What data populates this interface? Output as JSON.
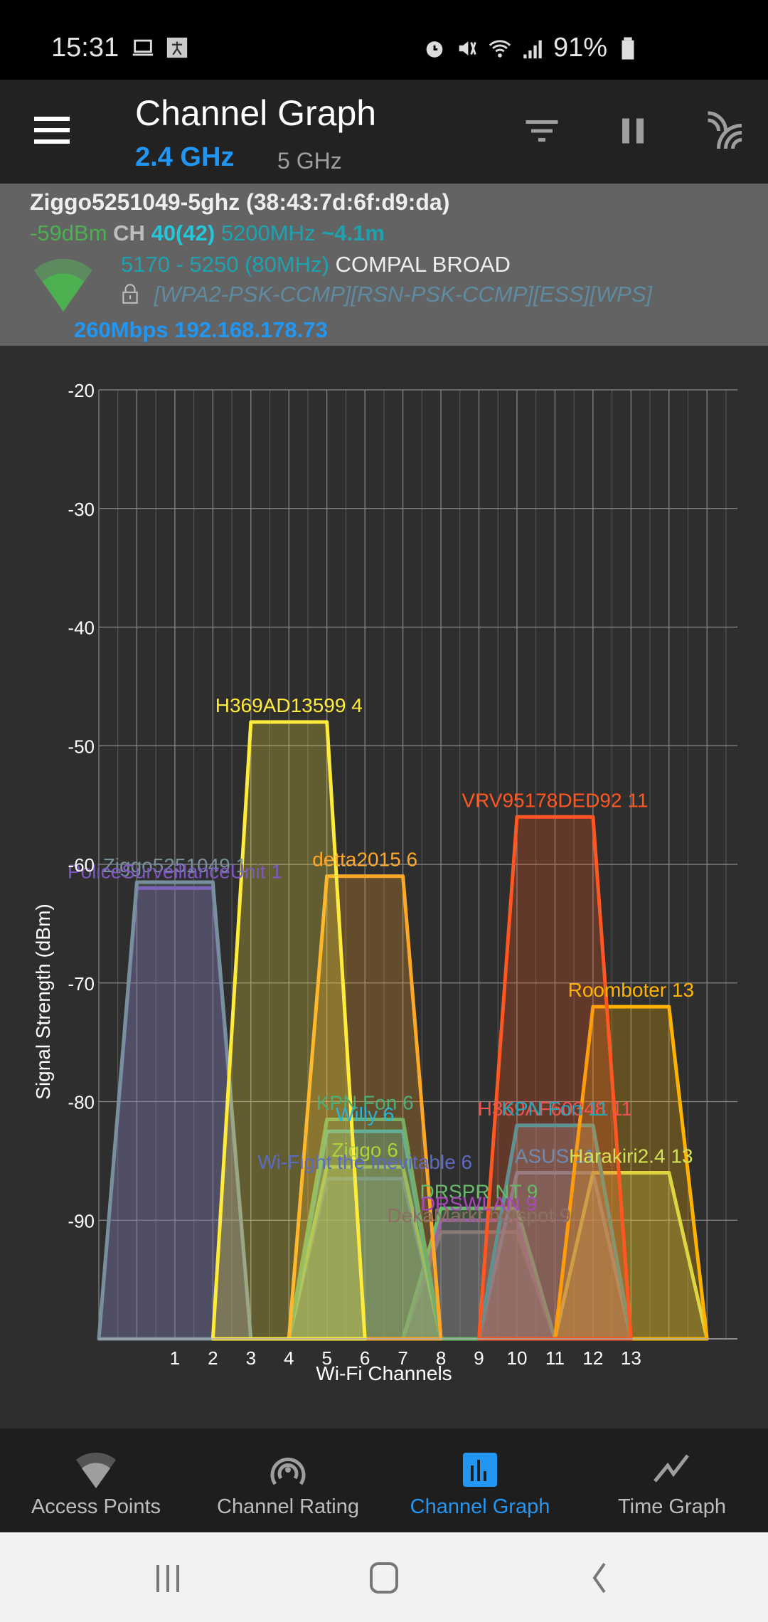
{
  "status_bar": {
    "time": "15:31",
    "battery": "91%",
    "left_icons": [
      "laptop-icon",
      "app-notification-icon"
    ],
    "right_icons": [
      "alarm-icon",
      "vibrate-icon",
      "wifi-data-icon",
      "cellular-signal-icon",
      "battery-icon"
    ]
  },
  "toolbar": {
    "title": "Channel Graph",
    "bands": [
      {
        "label": "2.4 GHz",
        "active": true
      },
      {
        "label": "5 GHz",
        "active": false
      }
    ],
    "actions": [
      "filter-icon",
      "pause-icon",
      "wifi-scan-icon"
    ]
  },
  "connected": {
    "ssid_line": "Ziggo5251049-5ghz (38:43:7d:6f:d9:da)",
    "signal": "-59dBm",
    "ch_label": "CH",
    "channel": "40(42)",
    "frequency": "5200MHz",
    "distance": "~4.1m",
    "range": "5170 - 5250 (80MHz)",
    "vendor": "COMPAL BROAD",
    "security": "[WPA2-PSK-CCMP][RSN-PSK-CCMP][ESS][WPS]",
    "link": "260Mbps 192.168.178.73",
    "colors": {
      "signal": "#4caf50",
      "channel": "#26c6da",
      "freq": "#1fa2b0",
      "link": "#2196f3"
    }
  },
  "chart_data": {
    "type": "area",
    "title": "Channel Graph",
    "xlabel": "Wi-Fi Channels",
    "ylabel": "Signal Strength (dBm)",
    "xlim": [
      -1,
      15.8
    ],
    "ylim": [
      -100,
      -20
    ],
    "yticks": [
      -20,
      -30,
      -40,
      -50,
      -60,
      -70,
      -80,
      -90
    ],
    "xticks": [
      1,
      2,
      3,
      4,
      5,
      6,
      7,
      8,
      9,
      10,
      11,
      12,
      13
    ],
    "grid": true,
    "series": [
      {
        "name": "Ziggo5251049",
        "channel": 1,
        "dbm": -61.5,
        "color": "#78909c",
        "label": "Ziggo5251049 1"
      },
      {
        "name": "PoliceSurveillanceUnit",
        "channel": 1,
        "dbm": -62,
        "color": "#7e57c2",
        "label": "PoliceSurveillanceUnit 1"
      },
      {
        "name": "H369AD13599",
        "channel": 4,
        "dbm": -48,
        "color": "#ffeb3b",
        "label": "H369AD13599 4"
      },
      {
        "name": "detta2015",
        "channel": 6,
        "dbm": -61,
        "color": "#ffa726",
        "label": "detta2015 6"
      },
      {
        "name": "KPN Fon",
        "channel": 6,
        "dbm": -81.5,
        "color": "#4caf7a",
        "label": "KPN Fon 6"
      },
      {
        "name": "Willy",
        "channel": 6,
        "dbm": -82.5,
        "color": "#29b6d6",
        "label": "Willy 6"
      },
      {
        "name": "Ziggo",
        "channel": 6,
        "dbm": -85.5,
        "color": "#aed13e",
        "label": "Ziggo 6"
      },
      {
        "name": "Wi-Fight the Inevitable",
        "channel": 6,
        "dbm": -86.5,
        "color": "#5c6bc0",
        "label": "Wi-Fight the Inevitable 6"
      },
      {
        "name": "DRSPR NT",
        "channel": 9,
        "dbm": -89,
        "color": "#66bb6a",
        "label": "DRSPR NT 9"
      },
      {
        "name": "DRSWLAN",
        "channel": 9,
        "dbm": -90,
        "color": "#ab47bc",
        "label": "DRSWLAN 9"
      },
      {
        "name": "DekaMarkt hotspot",
        "channel": 9,
        "dbm": -91,
        "color": "#8d6e63",
        "label": "DekaMarkt hotspot 9"
      },
      {
        "name": "VRV95178DED92",
        "channel": 11,
        "dbm": -56,
        "color": "#ff5722",
        "label": "VRV95178DED92 11"
      },
      {
        "name": "H369AF60348",
        "channel": 11,
        "dbm": -82,
        "color": "#ef5350",
        "label": "H369AF60348 11"
      },
      {
        "name": "KPN Fon",
        "channel": 11,
        "dbm": -82,
        "color": "#26a6b6",
        "label": "KPN Fon 11"
      },
      {
        "name": "ASUS",
        "channel": 11,
        "dbm": -86,
        "color": "#6d8bb0",
        "label": "ASUS 11"
      },
      {
        "name": "Roomboter",
        "channel": 13,
        "dbm": -72,
        "color": "#ffb300",
        "label": "Roomboter 13"
      },
      {
        "name": "Harakiri2.4",
        "channel": 13,
        "dbm": -86,
        "color": "#d4e157",
        "label": "Harakiri2.4 13"
      }
    ]
  },
  "bottom_nav": [
    {
      "label": "Access Points",
      "icon": "wifi-signal-icon",
      "active": false
    },
    {
      "label": "Channel Rating",
      "icon": "broadcast-icon",
      "active": false
    },
    {
      "label": "Channel Graph",
      "icon": "bar-chart-icon",
      "active": true
    },
    {
      "label": "Time Graph",
      "icon": "line-chart-icon",
      "active": false
    }
  ],
  "system_nav": [
    "recents-icon",
    "home-icon",
    "back-icon"
  ]
}
